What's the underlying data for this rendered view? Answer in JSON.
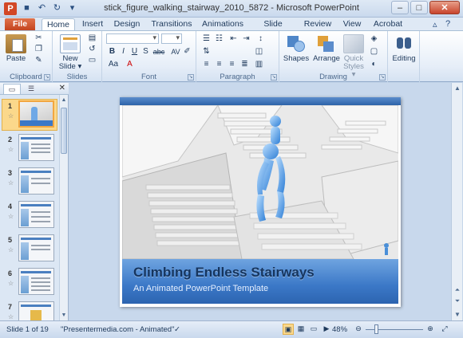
{
  "window": {
    "title": "stick_figure_walking_stairway_2010_5872  -  Microsoft PowerPoint",
    "app_icon": "P"
  },
  "quick_access": [
    "save-icon",
    "undo-icon",
    "redo-icon",
    "customize-icon"
  ],
  "tabs": [
    {
      "label": "File"
    },
    {
      "label": "Home"
    },
    {
      "label": "Insert"
    },
    {
      "label": "Design"
    },
    {
      "label": "Transitions"
    },
    {
      "label": "Animations"
    },
    {
      "label": "Slide Show"
    },
    {
      "label": "Review"
    },
    {
      "label": "View"
    },
    {
      "label": "Acrobat"
    }
  ],
  "ribbon": {
    "clipboard": {
      "label": "Clipboard",
      "paste": "Paste"
    },
    "slides": {
      "label": "Slides",
      "new_slide_1": "New",
      "new_slide_2": "Slide ▾"
    },
    "font": {
      "label": "Font",
      "buttons": [
        "B",
        "I",
        "U",
        "S",
        "abc",
        "AV",
        "Aa",
        "A"
      ]
    },
    "paragraph": {
      "label": "Paragraph"
    },
    "drawing": {
      "label": "Drawing",
      "shapes": "Shapes",
      "arrange": "Arrange",
      "quick_styles_1": "Quick",
      "quick_styles_2": "Styles ▾"
    },
    "editing": {
      "label": "Editing"
    }
  },
  "slides_panel": {
    "thumbnails": [
      {
        "num": "1"
      },
      {
        "num": "2"
      },
      {
        "num": "3"
      },
      {
        "num": "4"
      },
      {
        "num": "5"
      },
      {
        "num": "6"
      },
      {
        "num": "7"
      }
    ]
  },
  "slide": {
    "title": "Climbing Endless Stairways",
    "subtitle": "An Animated  PowerPoint  Template"
  },
  "status": {
    "slide_info": "Slide 1 of 19",
    "theme": "\"Presentermedia.com - Animated\"",
    "zoom": "48%"
  },
  "colors": {
    "accent": "#2d63a8",
    "caption_bar": "#3b78c7",
    "file_tab": "#c2411b",
    "selected": "#f2a640"
  }
}
